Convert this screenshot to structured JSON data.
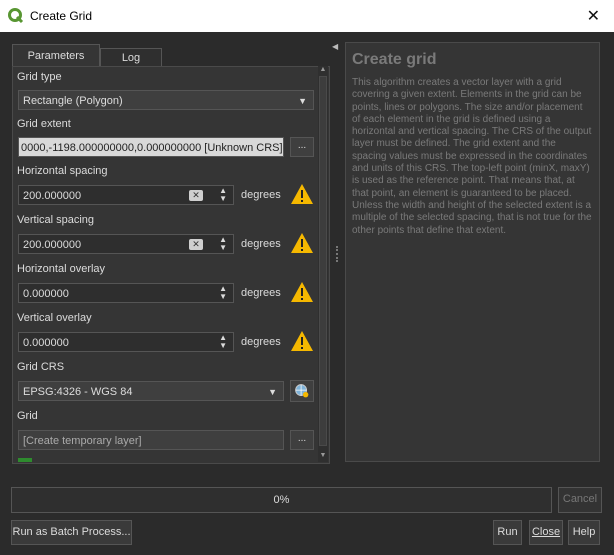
{
  "window": {
    "title": "Create Grid",
    "close_glyph": "✕",
    "logo_icon": "qgis-logo-icon"
  },
  "tabs": [
    {
      "label": "Parameters"
    },
    {
      "label": "Log"
    }
  ],
  "params": {
    "grid_type": {
      "label": "Grid type",
      "value": "Rectangle (Polygon)"
    },
    "grid_extent": {
      "label": "Grid extent",
      "value": "0000,-1198.000000000,0.000000000 [Unknown CRS]",
      "button": "..."
    },
    "hspacing": {
      "label": "Horizontal spacing",
      "value": "200.000000",
      "unit": "degrees"
    },
    "vspacing": {
      "label": "Vertical spacing",
      "value": "200.000000",
      "unit": "degrees"
    },
    "hoverlay": {
      "label": "Horizontal overlay",
      "value": "0.000000",
      "unit": "degrees"
    },
    "voverlay": {
      "label": "Vertical overlay",
      "value": "0.000000",
      "unit": "degrees"
    },
    "grid_crs": {
      "label": "Grid CRS",
      "value": "EPSG:4326 - WGS 84"
    },
    "grid": {
      "label": "Grid",
      "value": "[Create temporary layer]",
      "button": "..."
    }
  },
  "help": {
    "title": "Create grid",
    "body": "This algorithm creates a vector layer with a grid covering a given extent. Elements in the grid can be points, lines or polygons. The size and/or placement of each element in the grid is defined using a horizontal and vertical spacing. The CRS of the output layer must be defined. The grid extent and the spacing values must be expressed in the coordinates and units of this CRS. The top-left point (minX, maxY) is used as the reference point. That means that, at that point, an element is guaranteed to be placed. Unless the width and height of the selected extent is a multiple of the selected spacing, that is not true for the other points that define that extent."
  },
  "progress": {
    "text": "0%",
    "value": 0
  },
  "buttons": {
    "cancel": "Cancel",
    "batch": "Run as Batch Process...",
    "run": "Run",
    "close": "Close",
    "help": "Help"
  },
  "colors": {
    "warning": "#f5b800",
    "accent_green": "#2e8b2e"
  }
}
